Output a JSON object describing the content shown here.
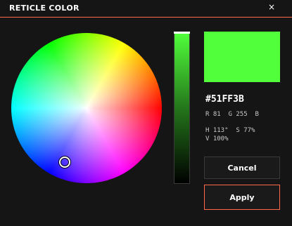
{
  "window": {
    "title": "RETICLE COLOR",
    "close_label": "×"
  },
  "color": {
    "hex": "#51FF3B",
    "swatch_color": "#51ff3b",
    "r_label": "R",
    "r": "81",
    "g_label": "G",
    "g": "255",
    "b_label": "B",
    "b": "",
    "h_label": "H",
    "h": "113°",
    "s_label": "S",
    "s": "77%",
    "v_label": "V",
    "v": "100%"
  },
  "slider": {
    "value_fraction": 1.0
  },
  "buttons": {
    "cancel": "Cancel",
    "apply": "Apply"
  },
  "theme": {
    "accent": "#ff6a4d",
    "background": "#151515"
  }
}
